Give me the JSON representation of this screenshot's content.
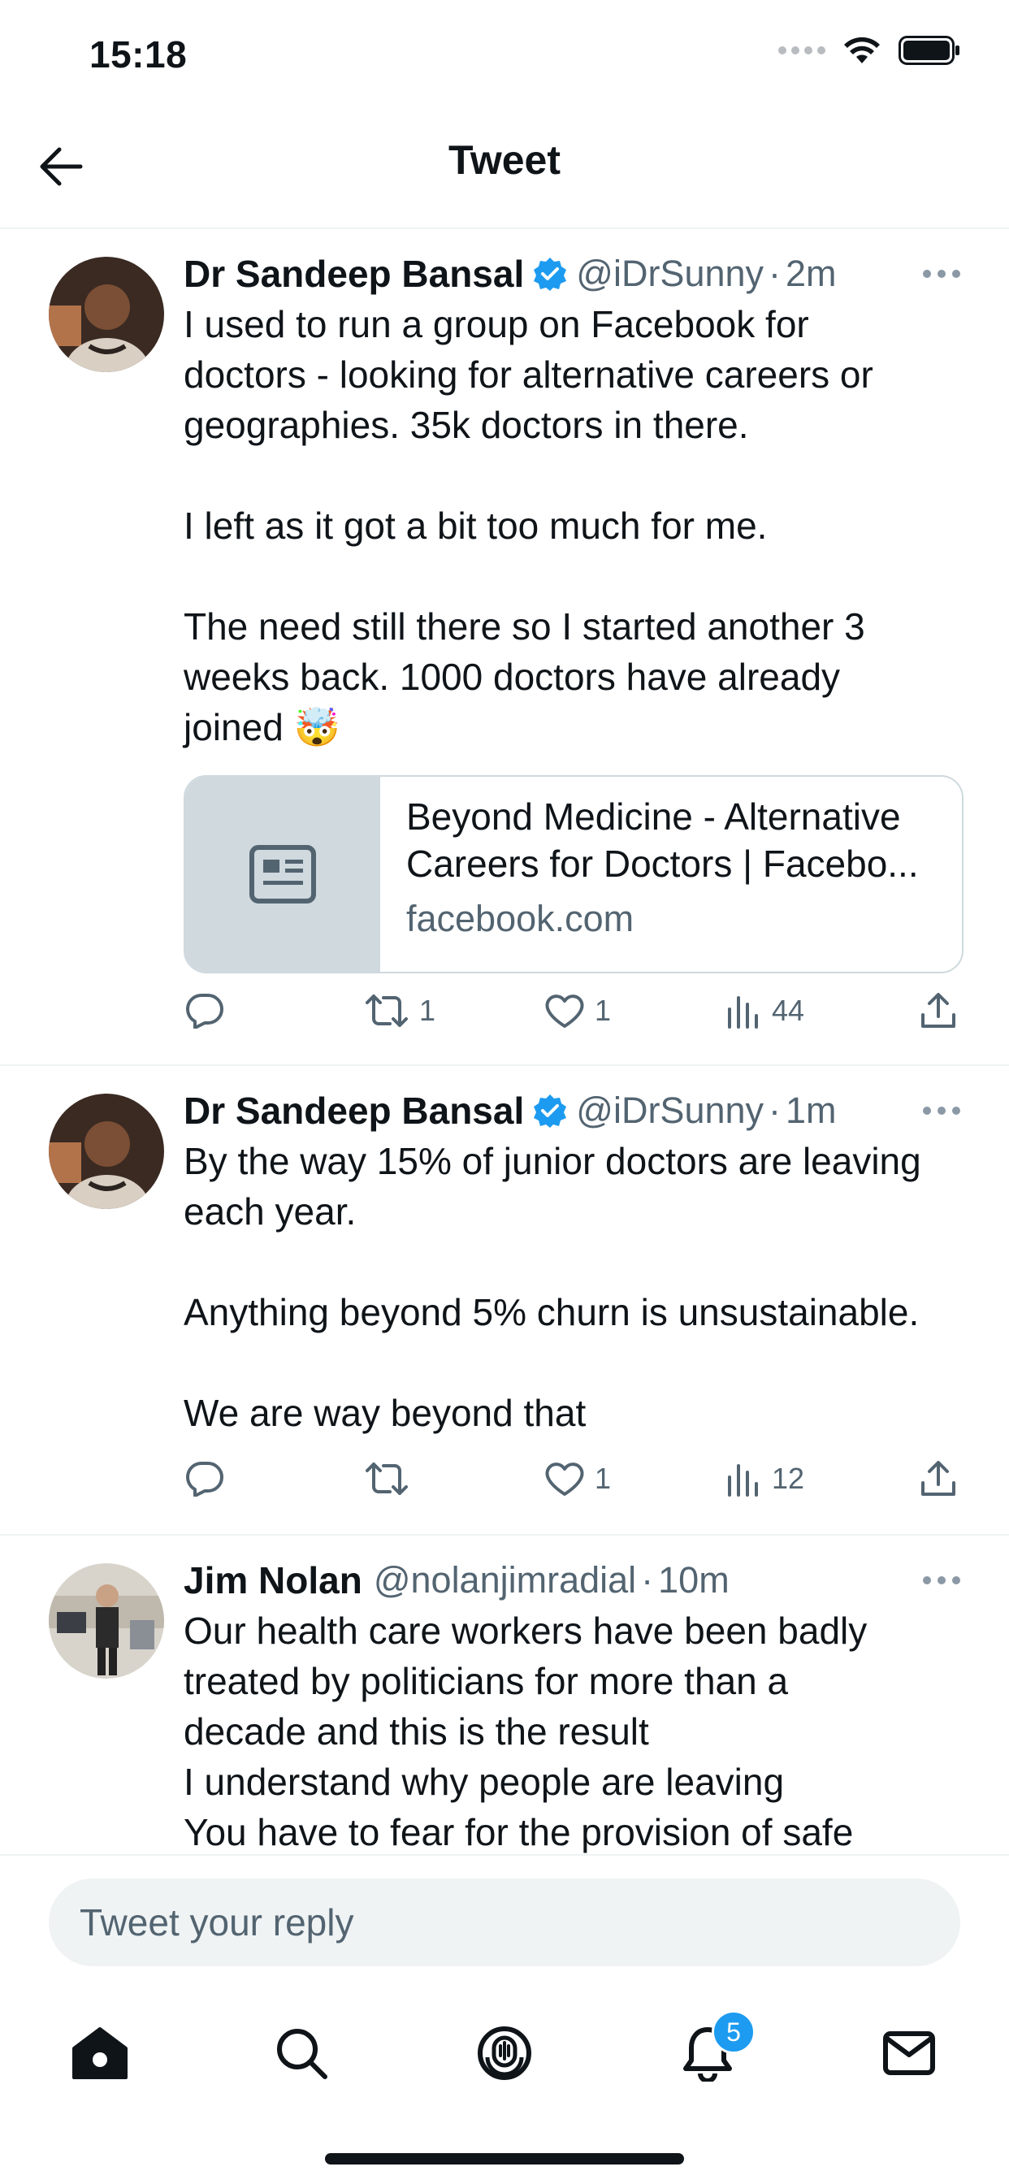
{
  "status": {
    "time": "15:18"
  },
  "header": {
    "title": "Tweet"
  },
  "tweets": [
    {
      "name": "Dr Sandeep Bansal",
      "handle": "@iDrSunny",
      "sep": "·",
      "time": "2m",
      "text": "I used to run a group on Facebook for\ndoctors - looking for alternative careers or\ngeographies. 35k doctors in there.\n\nI left as it got a bit too much for me.\n\nThe need still there so I started another 3\nweeks back. 1000 doctors have already\njoined 🤯",
      "link": {
        "title": "Beyond Medicine - Alternative\nCareers for Doctors | Facebo...",
        "domain": "facebook.com"
      },
      "retweets": "1",
      "likes": "1",
      "views": "44"
    },
    {
      "name": "Dr Sandeep Bansal",
      "handle": "@iDrSunny",
      "sep": "·",
      "time": "1m",
      "text": "By the way 15% of junior doctors are leaving\neach year.\n\nAnything beyond 5% churn is unsustainable.\n\nWe are way beyond that",
      "retweets": "",
      "likes": "1",
      "views": "12"
    },
    {
      "name": "Jim Nolan",
      "handle": "@nolanjimradial",
      "sep": "·",
      "time": "10m",
      "text": "Our health care workers have been badly\ntreated by politicians for more than a\ndecade and this is the result\nI understand why people are leaving\nYou have to fear for the provision of safe"
    }
  ],
  "reply": {
    "placeholder": "Tweet your reply"
  },
  "tabs": {
    "notifications_badge": "5"
  },
  "colors": {
    "accent": "#1d9bf0",
    "secondary_text": "#536471",
    "card_bg": "#cfd9de"
  }
}
